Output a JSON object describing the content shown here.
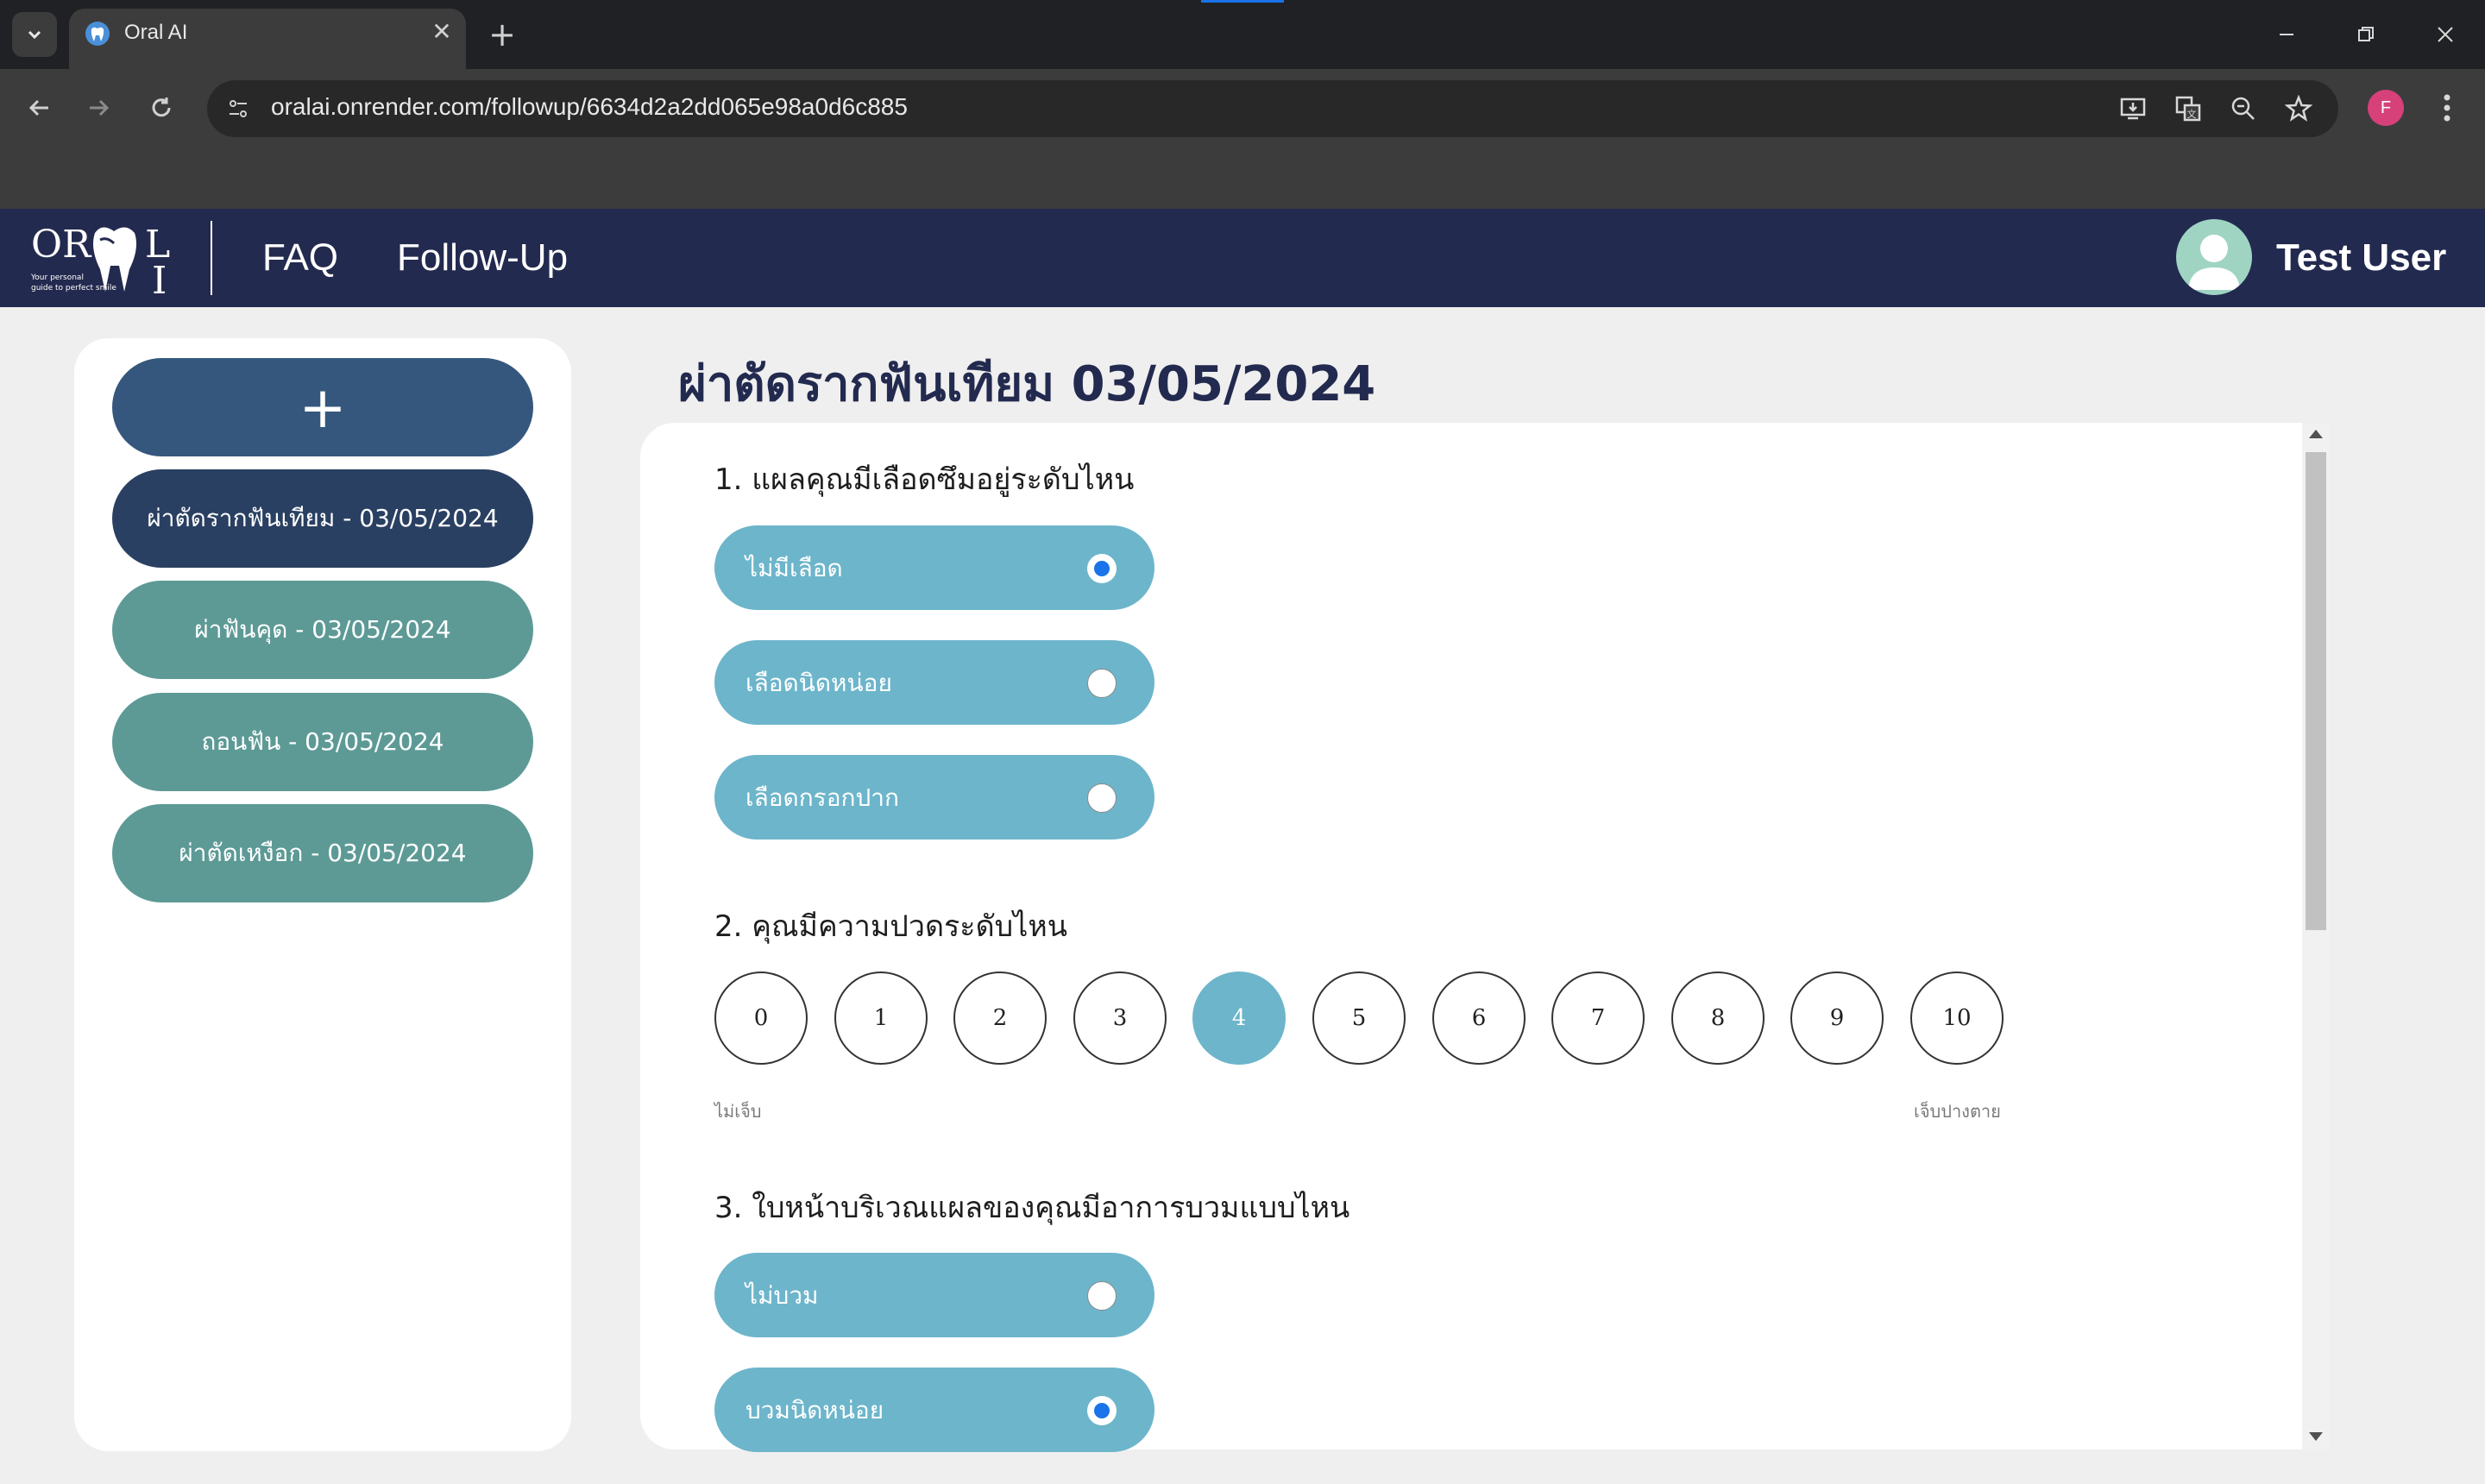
{
  "browser": {
    "tab_title": "Oral AI",
    "new_tab": "+",
    "close_tab": "✕",
    "url": "oralai.onrender.com/followup/6634d2a2dd065e98a0d6c885",
    "profile_initial": "F"
  },
  "header": {
    "logo_text": {
      "top": "OR",
      "bottom_right": "L",
      "bottom_i": "I",
      "tagline_1": "Your personal",
      "tagline_2": "guide to perfect smile"
    },
    "nav": [
      {
        "label": "FAQ"
      },
      {
        "label": "Follow-Up"
      }
    ],
    "user_name": "Test User"
  },
  "sidebar": {
    "add_label": "+",
    "items": [
      {
        "label": "ผ่าตัดรากฟันเทียม - 03/05/2024",
        "active": true
      },
      {
        "label": "ผ่าฟันคุด - 03/05/2024",
        "active": false
      },
      {
        "label": "ถอนฟัน - 03/05/2024",
        "active": false
      },
      {
        "label": "ผ่าตัดเหงือก - 03/05/2024",
        "active": false
      }
    ]
  },
  "main": {
    "title": "ผ่าตัดรากฟันเทียม 03/05/2024",
    "questions": [
      {
        "text": "1. แผลคุณมีเลือดซึมอยู่ระดับไหน",
        "options": [
          {
            "label": "ไม่มีเลือด",
            "checked": true
          },
          {
            "label": "เลือดนิดหน่อย",
            "checked": false
          },
          {
            "label": "เลือดกรอกปาก",
            "checked": false
          }
        ]
      },
      {
        "text": "2. คุณมีความปวดระดับไหน",
        "scale": [
          "0",
          "1",
          "2",
          "3",
          "4",
          "5",
          "6",
          "7",
          "8",
          "9",
          "10"
        ],
        "selected": 4,
        "min_label": "ไม่เจ็บ",
        "max_label": "เจ็บปางตาย"
      },
      {
        "text": "3. ใบหน้าบริเวณแผลของคุณมีอาการบวมแบบไหน",
        "options": [
          {
            "label": "ไม่บวม",
            "checked": false
          },
          {
            "label": "บวมนิดหน่อย",
            "checked": true
          }
        ]
      }
    ]
  },
  "colors": {
    "header_bg": "#232a4f",
    "option_bg": "#6db5cb",
    "sidebar_item": "#5d9a96",
    "sidebar_active": "#2a4062",
    "add_button": "#35577d"
  }
}
